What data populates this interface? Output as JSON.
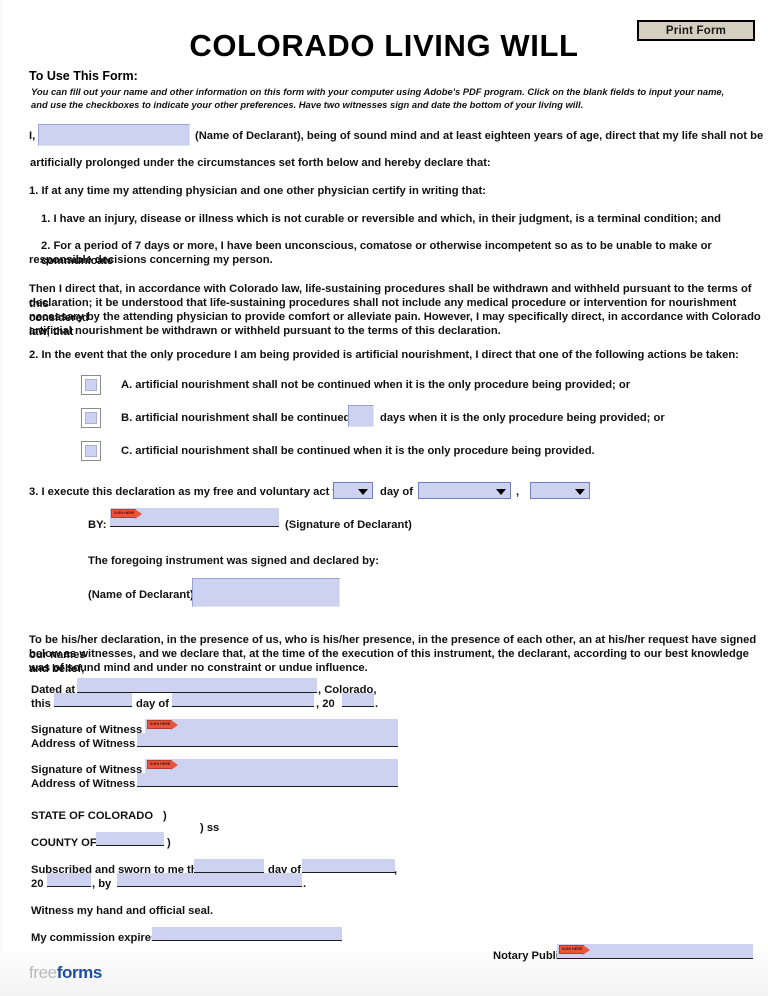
{
  "header": {
    "print_button": "Print Form",
    "title": "COLORADO LIVING WILL",
    "instructions_heading": "To Use This Form:",
    "instructions_body": "You can fill out your name and other information on this form with your computer using Adobe's PDF program. Click on the blank fields to input your name, and use the checkboxes to indicate your other preferences. Have two witnesses sign and date the bottom of your living will."
  },
  "body": {
    "intro_prefix": "I,",
    "intro_suffix": "(Name of Declarant), being of sound mind and at least eighteen years of age, direct that my life shall not be",
    "intro_line2": "artificially prolonged under the circumstances set forth below and hereby declare that:",
    "clause1": "1. If at any time my attending physician and one other physician certify in writing that:",
    "clause1a": "1. I have an injury, disease or illness which is not curable or reversible and which, in their judgment, is a terminal condition; and",
    "clause1b_line1": "2. For a period of 7 days or more, I have been unconscious, comatose or otherwise incompetent so as to be unable to make or communicate",
    "clause1b_line2": "responsible decisions concerning my person.",
    "then_para_line1": "Then I direct that, in accordance with Colorado law, life-sustaining procedures shall be withdrawn and withheld pursuant to the terms of this",
    "then_para_line2": "declaration; it be understood that life-sustaining procedures shall not include any medical procedure or intervention for nourishment considered",
    "then_para_line3": "necessary by the attending physician to provide comfort or alleviate pain. However, I may specifically direct, in accordance with Colorado law, that",
    "then_para_line4": "artificial nourishment be withdrawn or withheld pursuant to the terms of this declaration.",
    "clause2": "2.  In the event that the only procedure I am being provided is artificial nourishment, I direct that one of the following actions be taken:",
    "option_a": "A. artificial nourishment shall not be continued when it is the only procedure being provided; or",
    "option_b_before": "B. artificial nourishment shall be continued for",
    "option_b_after": "days when it is the only procedure being provided; or",
    "option_c": "C. artificial nourishment shall be continued when it is the only procedure being provided.",
    "clause3_before": "3. I execute this declaration as my free and voluntary act this",
    "clause3_dayof": "day of",
    "clause3_comma": ",",
    "by_label": "BY:",
    "signature_of_declarant": "(Signature of Declarant)",
    "foregoing": "The foregoing instrument was signed and declared by:",
    "name_of_declarant_label": "(Name of Declarant)",
    "witness_para_line1": "To be his/her declaration, in the presence of us, who is his/her presence, in the presence of each other, an at his/her request have signed our names",
    "witness_para_line2": "below as witnesses, and we declare that, at the time of the execution of this instrument, the declarant, according to our best knowledge and belief,",
    "witness_para_line3": "was of sound mind and under no constraint or undue influence."
  },
  "dated": {
    "dated_at": "Dated at",
    "colorado": ", Colorado,",
    "this": "this",
    "day_of": "day of",
    "comma_20": ", 20",
    "period": "."
  },
  "witnesses": [
    {
      "signature_label": "Signature of Witness 1:",
      "address_label": "Address of Witness 1:"
    },
    {
      "signature_label": "Signature of Witness 2:",
      "address_label": "Address of Witness 2:"
    }
  ],
  "notary": {
    "state_line": "STATE OF COLORADO",
    "paren1": ")",
    "ss": ") ss",
    "county_of": "COUNTY OF",
    "paren2": ")",
    "subscribed": "Subscribed and sworn to me this",
    "day_of": "day of",
    "comma": ",",
    "twenty": "20",
    "by": ", by",
    "period": ".",
    "witness_seal": "Witness my hand and official seal.",
    "commission_expires": "My commission expires:",
    "notary_public_label": "Notary Public"
  },
  "sign_tag_text": "SIGN HERE",
  "footer": {
    "logo_light": "free",
    "logo_bold": "forms"
  },
  "colors": {
    "field_fill": "#ccd2f0",
    "field_border": "#9aa3d0",
    "print_button_bg": "#d4cfc0",
    "sign_tag": "#e8553c",
    "logo_blue": "#1d4fa0",
    "logo_gray": "#b9b9b9"
  }
}
